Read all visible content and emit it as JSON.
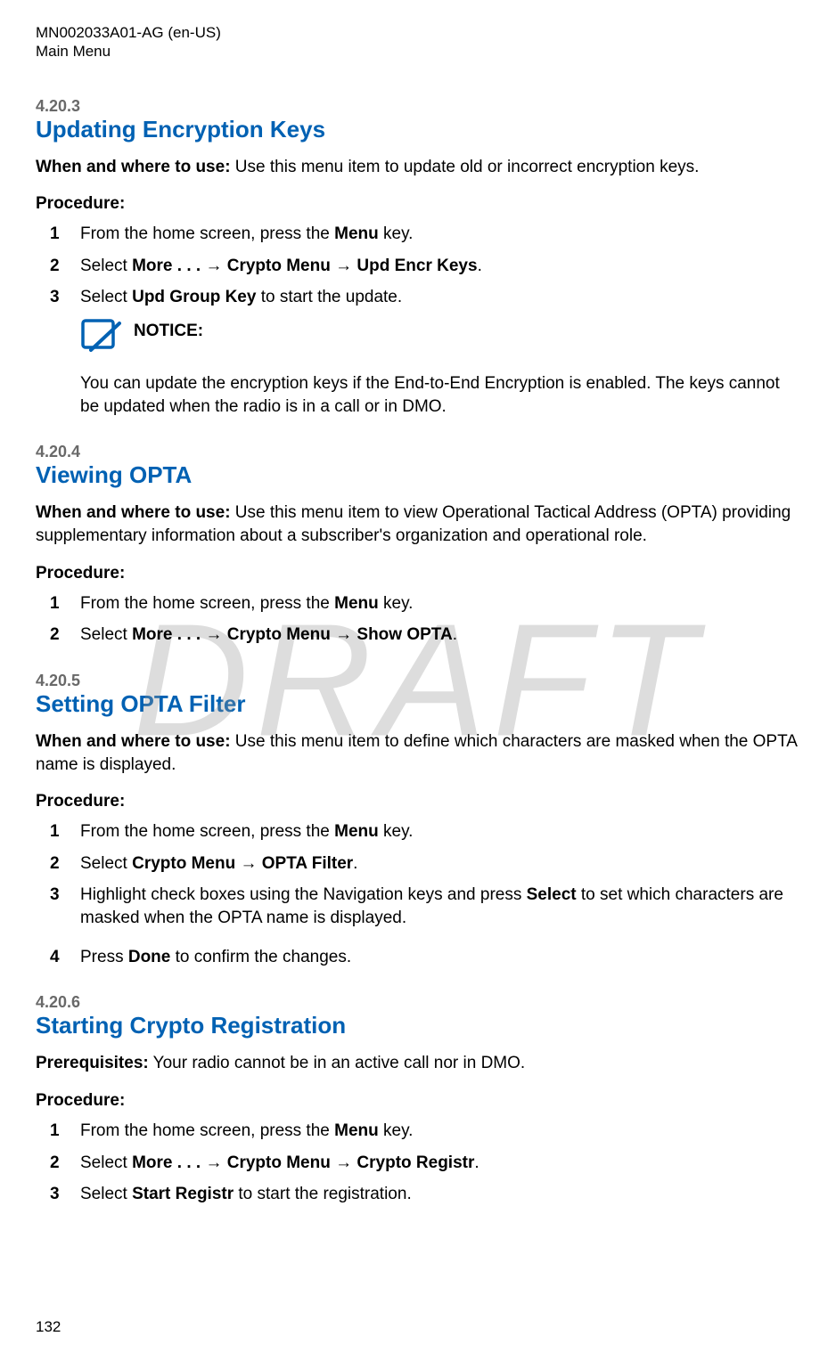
{
  "header": {
    "doc_id": "MN002033A01-AG (en-US)",
    "section": "Main Menu"
  },
  "watermark": "DRAFT",
  "footer": {
    "page_number": "132"
  },
  "sections": [
    {
      "num": "4.20.3",
      "title": "Updating Encryption Keys",
      "when_label": "When and where to use:",
      "when_text": " Use this menu item to update old or incorrect encryption keys.",
      "proc_label": "Procedure:",
      "steps": [
        {
          "n": "1",
          "pre": "From the home screen, press the ",
          "b1": "Menu",
          "post": " key."
        },
        {
          "n": "2",
          "pre": "Select ",
          "b1": "More . . .",
          "mid1": " → ",
          "b2": "Crypto Menu",
          "mid2": " → ",
          "b3": "Upd Encr Keys",
          "post": "."
        },
        {
          "n": "3",
          "pre": "Select ",
          "b1": "Upd Group Key",
          "post": " to start the update."
        }
      ],
      "notice": {
        "label": "NOTICE:",
        "text": "You can update the encryption keys if the End-to-End Encryption is enabled. The keys cannot be updated when the radio is in a call or in DMO."
      }
    },
    {
      "num": "4.20.4",
      "title": "Viewing OPTA",
      "when_label": "When and where to use:",
      "when_text": " Use this menu item to view Operational Tactical Address (OPTA) providing supplementary information about a subscriber's organization and operational role.",
      "proc_label": "Procedure:",
      "steps": [
        {
          "n": "1",
          "pre": "From the home screen, press the ",
          "b1": "Menu",
          "post": " key."
        },
        {
          "n": "2",
          "pre": "Select ",
          "b1": "More . . .",
          "mid1": " → ",
          "b2": "Crypto Menu",
          "mid2": " → ",
          "b3": "Show OPTA",
          "post": "."
        }
      ]
    },
    {
      "num": "4.20.5",
      "title": "Setting OPTA Filter",
      "when_label": "When and where to use:",
      "when_text": " Use this menu item to define which characters are masked when the OPTA name is displayed.",
      "proc_label": "Procedure:",
      "steps": [
        {
          "n": "1",
          "pre": "From the home screen, press the ",
          "b1": "Menu",
          "post": " key."
        },
        {
          "n": "2",
          "pre": "Select ",
          "b1": "Crypto Menu",
          "mid1": " → ",
          "b2": "OPTA Filter",
          "post": "."
        },
        {
          "n": "3",
          "pre": "Highlight check boxes using the Navigation keys and press ",
          "b1": "Select",
          "post": " to set which characters are masked when the OPTA name is displayed."
        },
        {
          "n": "4",
          "pre": "Press ",
          "b1": "Done",
          "post": " to confirm the changes."
        }
      ]
    },
    {
      "num": "4.20.6",
      "title": "Starting Crypto Registration",
      "prereq_label": "Prerequisites:",
      "prereq_text": " Your radio cannot be in an active call nor in DMO.",
      "proc_label": "Procedure:",
      "steps": [
        {
          "n": "1",
          "pre": "From the home screen, press the ",
          "b1": "Menu",
          "post": " key."
        },
        {
          "n": "2",
          "pre": "Select ",
          "b1": "More . . .",
          "mid1": " → ",
          "b2": "Crypto Menu",
          "mid2": " → ",
          "b3": "Crypto Registr",
          "post": "."
        },
        {
          "n": "3",
          "pre": "Select ",
          "b1": "Start Registr",
          "post": " to start the registration."
        }
      ]
    }
  ]
}
